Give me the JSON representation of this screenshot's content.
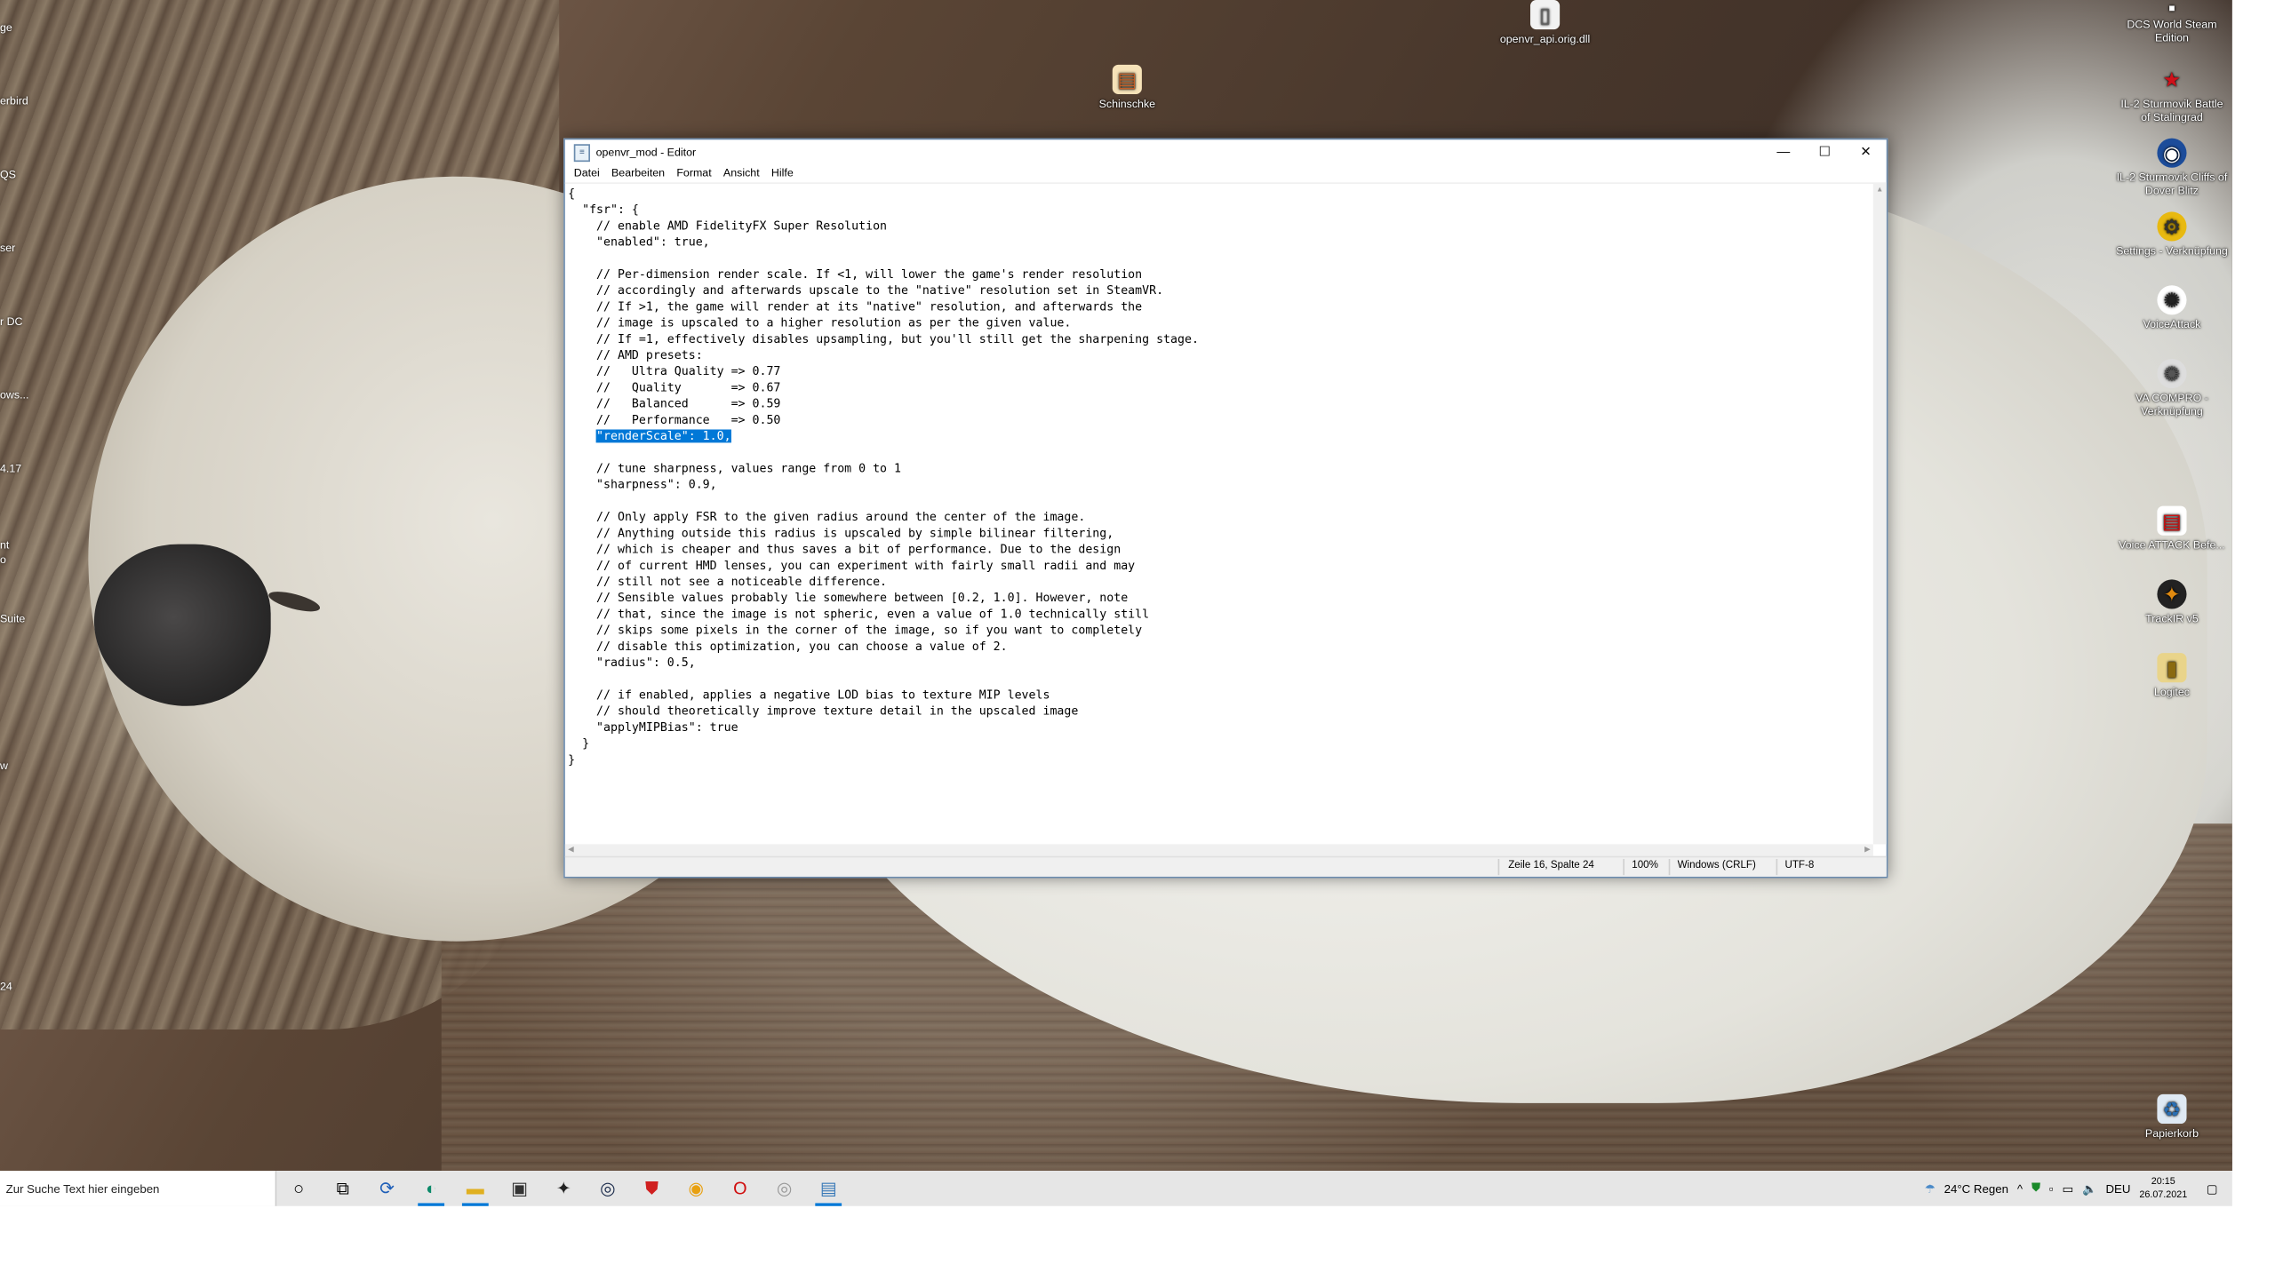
{
  "notepad": {
    "title": "openvr_mod - Editor",
    "menu": [
      "Datei",
      "Bearbeiten",
      "Format",
      "Ansicht",
      "Hilfe"
    ],
    "text_before_selection": "{\n  \"fsr\": {\n    // enable AMD FidelityFX Super Resolution\n    \"enabled\": true,\n\n    // Per-dimension render scale. If <1, will lower the game's render resolution\n    // accordingly and afterwards upscale to the \"native\" resolution set in SteamVR.\n    // If >1, the game will render at its \"native\" resolution, and afterwards the\n    // image is upscaled to a higher resolution as per the given value.\n    // If =1, effectively disables upsampling, but you'll still get the sharpening stage.\n    // AMD presets:\n    //   Ultra Quality => 0.77\n    //   Quality       => 0.67\n    //   Balanced      => 0.59\n    //   Performance   => 0.50\n    ",
    "selected_text": "\"renderScale\": 1.0,",
    "text_after_selection": "\n\n    // tune sharpness, values range from 0 to 1\n    \"sharpness\": 0.9,\n\n    // Only apply FSR to the given radius around the center of the image.\n    // Anything outside this radius is upscaled by simple bilinear filtering,\n    // which is cheaper and thus saves a bit of performance. Due to the design\n    // of current HMD lenses, you can experiment with fairly small radii and may\n    // still not see a noticeable difference.\n    // Sensible values probably lie somewhere between [0.2, 1.0]. However, note\n    // that, since the image is not spheric, even a value of 1.0 technically still\n    // skips some pixels in the corner of the image, so if you want to completely\n    // disable this optimization, you can choose a value of 2.\n    \"radius\": 0.5,\n\n    // if enabled, applies a negative LOD bias to texture MIP levels\n    // should theoretically improve texture detail in the upscaled image\n    \"applyMIPBias\": true\n  }\n}",
    "status": {
      "position": "Zeile 16, Spalte 24",
      "zoom": "100%",
      "line_ending": "Windows (CRLF)",
      "encoding": "UTF-8"
    }
  },
  "desktop_icons": [
    {
      "label": "openvr_api.orig.dll",
      "icon": "file-icon"
    },
    {
      "label": "Schinschke",
      "icon": "document-icon"
    },
    {
      "label": "DCS World Steam Edition",
      "icon": "game-icon"
    },
    {
      "label": "IL-2 Sturmovik Battle of Stalingrad",
      "icon": "star-icon"
    },
    {
      "label": "IL-2 Sturmovik Cliffs of Dover Blitz",
      "icon": "game-icon"
    },
    {
      "label": "Settings - Verknüpfung",
      "icon": "settings-icon"
    },
    {
      "label": "VoiceAttack",
      "icon": "voiceattack-icon"
    },
    {
      "label": "VA COMPRO - Verknüpfung",
      "icon": "shortcut-icon"
    },
    {
      "label": "Voice ATTACK Befe...",
      "icon": "document-icon"
    },
    {
      "label": "TrackIR v5",
      "icon": "trackir-icon"
    },
    {
      "label": "Logitec",
      "icon": "folder-icon"
    },
    {
      "label": "Papierkorb",
      "icon": "recycle-bin-icon"
    }
  ],
  "desktop_edge_labels": [
    "ge",
    "erbird",
    "QS",
    "ser",
    "r DC",
    "ows...",
    "4.17",
    "nt",
    "o",
    "Suite",
    "w",
    "24"
  ],
  "taskbar": {
    "search_placeholder": "Zur Suche Text hier eingeben",
    "weather": "24°C  Regen",
    "language": "DEU",
    "time": "20:15",
    "date": "26.07.2021"
  }
}
